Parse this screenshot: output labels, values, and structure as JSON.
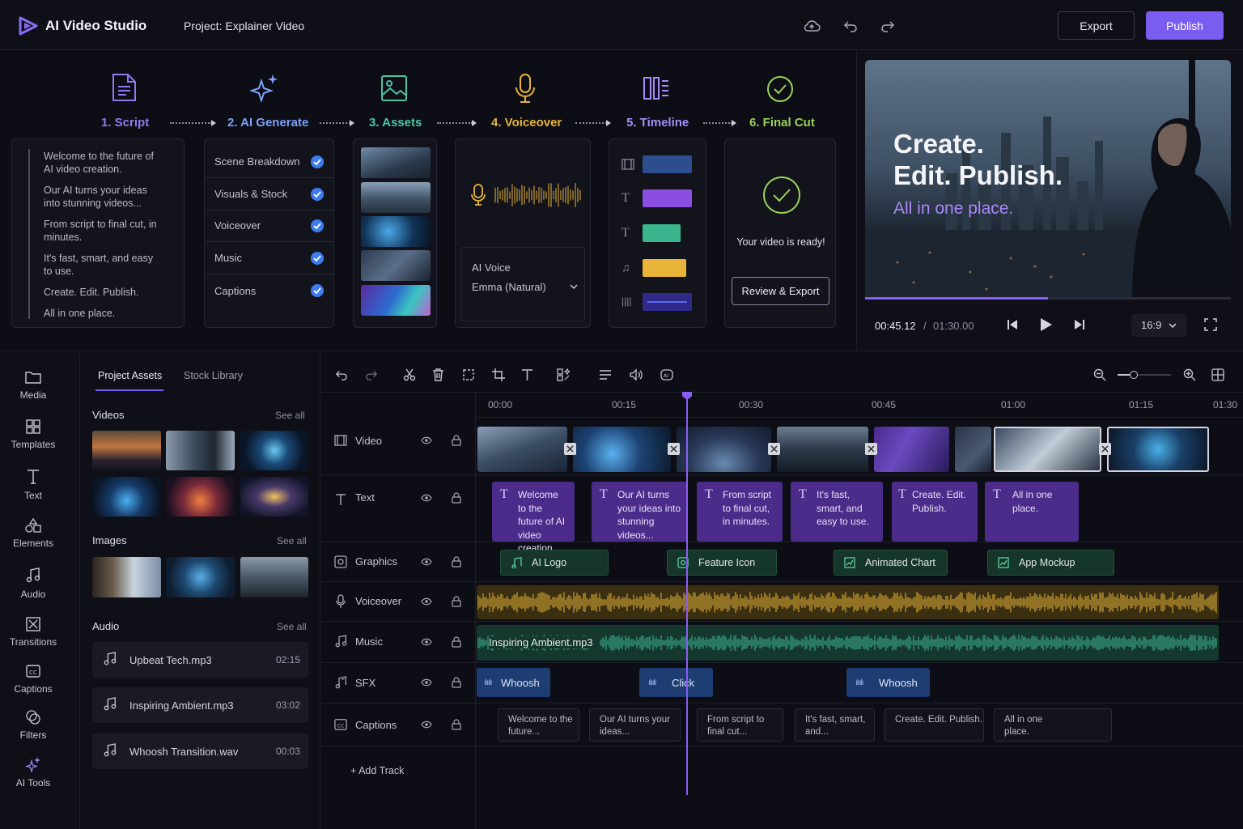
{
  "app": {
    "name": "AI Video Studio",
    "project_title": "Project: Explainer Video"
  },
  "header": {
    "export_label": "Export",
    "publish_label": "Publish"
  },
  "pipeline": {
    "steps": [
      {
        "label": "1. Script",
        "color": "#8b7cf0"
      },
      {
        "label": "2. AI Generate",
        "color": "#7ea0f8"
      },
      {
        "label": "3. Assets",
        "color": "#4fc3a2"
      },
      {
        "label": "4. Voiceover",
        "color": "#e8b43a"
      },
      {
        "label": "5. Timeline",
        "color": "#a78bfa"
      },
      {
        "label": "6. Final Cut",
        "color": "#9ad15a"
      }
    ],
    "script_lines": [
      "Welcome to the future of AI video creation.",
      "Our AI turns your ideas into stunning videos...",
      "From script to final cut, in minutes.",
      "It's fast, smart, and easy to use.",
      "Create. Edit. Publish.",
      "All in one place."
    ],
    "generate_items": [
      "Scene Breakdown",
      "Visuals & Stock",
      "Voiceover",
      "Music",
      "Captions"
    ],
    "voice": {
      "label": "AI Voice",
      "selected": "Emma (Natural)"
    },
    "final": {
      "message": "Your video is ready!",
      "button": "Review & Export"
    }
  },
  "preview": {
    "headline_1": "Create.",
    "headline_2": "Edit. Publish.",
    "subhead": "All in one place.",
    "current_time": "00:45.12",
    "separator": "/",
    "total_time": "01:30.00",
    "aspect": "16:9",
    "progress": 0.5
  },
  "sidebar": {
    "items": [
      {
        "label": "Media",
        "icon": "folder-icon"
      },
      {
        "label": "Templates",
        "icon": "grid-icon"
      },
      {
        "label": "Text",
        "icon": "text-icon"
      },
      {
        "label": "Elements",
        "icon": "shapes-icon"
      },
      {
        "label": "Audio",
        "icon": "music-icon"
      },
      {
        "label": "Transitions",
        "icon": "transition-icon"
      },
      {
        "label": "Captions",
        "icon": "captions-icon"
      },
      {
        "label": "Filters",
        "icon": "filters-icon"
      },
      {
        "label": "AI Tools",
        "icon": "sparkle-icon"
      }
    ]
  },
  "assets": {
    "tabs": [
      "Project Assets",
      "Stock Library"
    ],
    "videos_title": "Videos",
    "images_title": "Images",
    "audio_title": "Audio",
    "see_all": "See all",
    "audio_files": [
      {
        "name": "Upbeat Tech.mp3",
        "duration": "02:15"
      },
      {
        "name": "Inspiring Ambient.mp3",
        "duration": "03:02"
      },
      {
        "name": "Whoosh Transition.wav",
        "duration": "00:03"
      }
    ]
  },
  "timeline": {
    "ticks": [
      "00:00",
      "00:15",
      "00:30",
      "00:45",
      "01:00",
      "01:15",
      "01:30"
    ],
    "playhead_position": 0.278,
    "zoom_level": 0.3,
    "tracks": [
      "Video",
      "Text",
      "Graphics",
      "Voiceover",
      "Music",
      "SFX",
      "Captions"
    ],
    "text_clips": [
      "Welcome to the future of AI video creation.",
      "Our AI turns your ideas into stunning videos...",
      "From script to final cut, in minutes.",
      "It's fast, smart, and easy to use.",
      "Create. Edit. Publish.",
      "All in one place."
    ],
    "graphics_clips": [
      "AI Logo",
      "Feature Icon",
      "Animated Chart",
      "App Mockup"
    ],
    "music_clip": "Inspiring Ambient.mp3",
    "sfx_clips": [
      "Whoosh",
      "Click",
      "Whoosh"
    ],
    "caption_clips": [
      "Welcome to the future...",
      "Our AI turns your ideas...",
      "From script to final cut...",
      "It's fast, smart, and...",
      "Create. Edit. Publish.",
      "All in one place."
    ],
    "add_track": "+ Add Track"
  },
  "colors": {
    "accent": "#7b5cf0",
    "playhead": "#8b5cf6",
    "voiceover": "#e8b43a",
    "music": "#3fb89a",
    "sfx": "#1d3d73"
  }
}
